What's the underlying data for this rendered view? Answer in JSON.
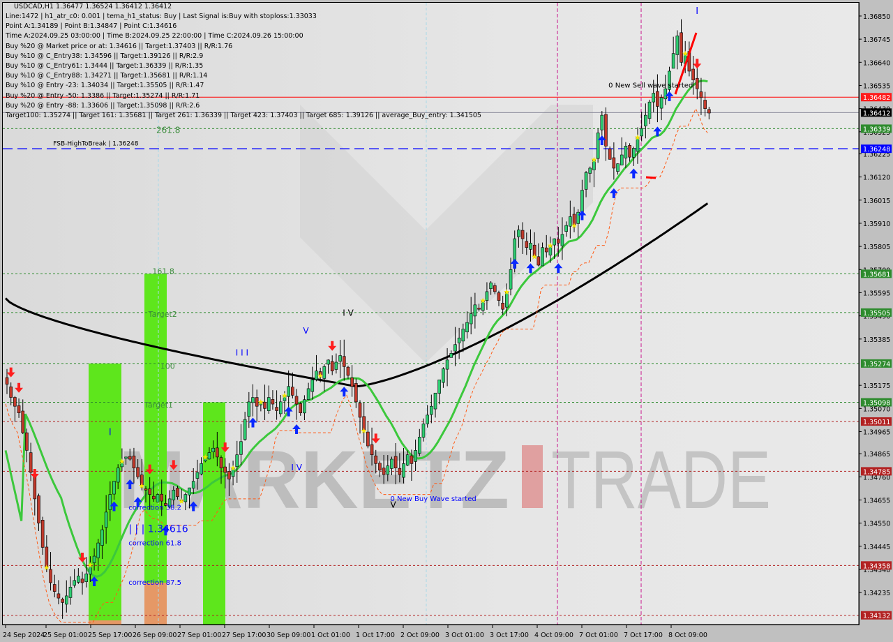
{
  "header": {
    "symbol_line": "USDCAD,H1  1.36477 1.36524 1.36412 1.36412",
    "info_lines": [
      "Line:1472 | h1_atr_c0: 0.001 | tema_h1_status: Buy | Last Signal is:Buy with stoploss:1.33033",
      "Point A:1.34189 | Point B:1.34847 | Point C:1.34616",
      "Time A:2024.09.25 03:00:00 | Time B:2024.09.25 22:00:00 | Time C:2024.09.26 15:00:00",
      "Buy %20 @ Market price or at: 1.34616 || Target:1.37403 || R/R:1.76",
      "Buy %10 @ C_Entry38: 1.34596 || Target:1.39126 || R/R:2.9",
      "Buy %10 @ C_Entry61: 1.3444 || Target:1.36339 || R/R:1.35",
      "Buy %10 @ C_Entry88: 1.34271 || Target:1.35681 || R/R:1.14",
      "Buy %10 @ Entry -23: 1.34034 || Target:1.35505 || R/R:1.47",
      "Buy %20 @ Entry -50: 1.3386 || Target:1.35274 || R/R:1.71",
      "Buy %20 @ Entry -88: 1.33606 || Target:1.35098 || R/R:2.6",
      "Target100: 1.35274 || Target 161: 1.35681 || Target 261: 1.36339 || Target 423: 1.37403 || Target 685: 1.39126 || average_Buy_entry: 1.341505"
    ]
  },
  "watermark": {
    "left": "MARKETZ",
    "right": "TRADE"
  },
  "chart_data": {
    "type": "candlestick",
    "symbol": "USDCAD",
    "timeframe": "H1",
    "ohlc_last": {
      "open": 1.36477,
      "high": 1.36524,
      "low": 1.36412,
      "close": 1.36412
    },
    "ylim": [
      1.3409,
      1.3691
    ],
    "y_ticks": [
      "1.36850",
      "1.36745",
      "1.36640",
      "1.36535",
      "1.36430",
      "1.36325",
      "1.36225",
      "1.36120",
      "1.36015",
      "1.35910",
      "1.35805",
      "1.35700",
      "1.35595",
      "1.35490",
      "1.35385",
      "1.35175",
      "1.35070",
      "1.34965",
      "1.34865",
      "1.34760",
      "1.34655",
      "1.34550",
      "1.34445",
      "1.34340",
      "1.34235"
    ],
    "x_ticks": [
      "24 Sep 2024",
      "25 Sep 01:00",
      "25 Sep 17:00",
      "26 Sep 09:00",
      "27 Sep 01:00",
      "27 Sep 17:00",
      "30 Sep 09:00",
      "1 Oct 01:00",
      "1 Oct 17:00",
      "2 Oct 09:00",
      "3 Oct 01:00",
      "3 Oct 17:00",
      "4 Oct 09:00",
      "7 Oct 01:00",
      "7 Oct 17:00",
      "8 Oct 09:00"
    ],
    "price_path": [
      1.3518,
      1.3512,
      1.3508,
      1.3505,
      1.3496,
      1.3488,
      1.3478,
      1.3466,
      1.3455,
      1.3444,
      1.3435,
      1.3428,
      1.3424,
      1.3421,
      1.3419,
      1.3422,
      1.3426,
      1.3429,
      1.3431,
      1.3428,
      1.3432,
      1.3436,
      1.344,
      1.3446,
      1.3452,
      1.346,
      1.3468,
      1.3474,
      1.348,
      1.3483,
      1.3485,
      1.3484,
      1.348,
      1.3476,
      1.3472,
      1.347,
      1.3468,
      1.3466,
      1.3468,
      1.3465,
      1.3463,
      1.3466,
      1.347,
      1.3467,
      1.3465,
      1.3468,
      1.3471,
      1.3474,
      1.3478,
      1.3482,
      1.3485,
      1.3487,
      1.3489,
      1.3485,
      1.348,
      1.3478,
      1.3475,
      1.348,
      1.3486,
      1.3492,
      1.3502,
      1.351,
      1.3512,
      1.3508,
      1.351,
      1.3507,
      1.3512,
      1.3509,
      1.3506,
      1.351,
      1.3513,
      1.3517,
      1.3513,
      1.3509,
      1.3505,
      1.3511,
      1.3516,
      1.352,
      1.3524,
      1.3522,
      1.3526,
      1.3529,
      1.3524,
      1.3528,
      1.3531,
      1.3526,
      1.3522,
      1.3517,
      1.351,
      1.3503,
      1.3497,
      1.349,
      1.3486,
      1.3482,
      1.3479,
      1.3477,
      1.3481,
      1.3484,
      1.348,
      1.3477,
      1.3482,
      1.3486,
      1.3482,
      1.3488,
      1.3494,
      1.35,
      1.3504,
      1.3508,
      1.3514,
      1.352,
      1.3525,
      1.3529,
      1.3532,
      1.3536,
      1.3539,
      1.3543,
      1.3546,
      1.355,
      1.3554,
      1.3552,
      1.3556,
      1.356,
      1.3564,
      1.356,
      1.3556,
      1.3552,
      1.356,
      1.357,
      1.3584,
      1.3588,
      1.3584,
      1.358,
      1.3582,
      1.3576,
      1.3572,
      1.358,
      1.3578,
      1.3581,
      1.3584,
      1.3582,
      1.3586,
      1.359,
      1.3594,
      1.359,
      1.3596,
      1.3606,
      1.3614,
      1.3616,
      1.362,
      1.3632,
      1.364,
      1.3626,
      1.362,
      1.3616,
      1.3618,
      1.3622,
      1.3626,
      1.3621,
      1.3625,
      1.363,
      1.3634,
      1.364,
      1.3646,
      1.365,
      1.3644,
      1.3648,
      1.3652,
      1.366,
      1.3668,
      1.3676,
      1.3664,
      1.3668,
      1.366,
      1.3656,
      1.3652,
      1.3648,
      1.3643,
      1.3641
    ],
    "horizontal_levels": [
      {
        "label": "1.36482",
        "value": 1.36482,
        "color": "#ff0000",
        "style": "solid"
      },
      {
        "label": "1.36412",
        "value": 1.36412,
        "color": "#000000",
        "style": "solid-grey"
      },
      {
        "label": "1.36339",
        "value": 1.36339,
        "color": "#2e8b2e",
        "style": "dotted"
      },
      {
        "label": "1.36248",
        "value": 1.36248,
        "color": "#0000ff",
        "style": "dashed"
      },
      {
        "label": "1.35681",
        "value": 1.35681,
        "color": "#2e8b2e",
        "style": "dotted"
      },
      {
        "label": "1.35505",
        "value": 1.35505,
        "color": "#2e8b2e",
        "style": "dotted"
      },
      {
        "label": "1.35274",
        "value": 1.35274,
        "color": "#2e8b2e",
        "style": "dotted"
      },
      {
        "label": "1.35098",
        "value": 1.35098,
        "color": "#2e8b2e",
        "style": "dotted"
      },
      {
        "label": "1.35011",
        "value": 1.35011,
        "color": "#b22222",
        "style": "dotted"
      },
      {
        "label": "1.34785",
        "value": 1.34785,
        "color": "#b22222",
        "style": "dotted"
      },
      {
        "label": "1.34358",
        "value": 1.34358,
        "color": "#b22222",
        "style": "dotted"
      },
      {
        "label": "1.34132",
        "value": 1.34132,
        "color": "#b22222",
        "style": "dotted"
      }
    ],
    "annotations": [
      {
        "text": "261.8",
        "price": 1.3632,
        "bar": 38,
        "color": "#3c8c3c",
        "size": 12
      },
      {
        "text": "FSB-HighToBreak | 1.36248",
        "price": 1.36262,
        "bar": 12,
        "color": "#000000",
        "size": 9
      },
      {
        "text": "161.8",
        "price": 1.3568,
        "bar": 37,
        "color": "#3c8c3c",
        "size": 11
      },
      {
        "text": "Target2",
        "price": 1.35485,
        "bar": 36,
        "color": "#3c8c3c",
        "size": 11
      },
      {
        "text": "100",
        "price": 1.3525,
        "bar": 39,
        "color": "#3c8c3c",
        "size": 11
      },
      {
        "text": "Target1",
        "price": 1.35075,
        "bar": 35,
        "color": "#3c8c3c",
        "size": 11
      },
      {
        "text": "correction 38.2",
        "price": 1.3461,
        "bar": 31,
        "color": "#0000ff",
        "size": 10
      },
      {
        "text": "| | | 1.34616",
        "price": 1.3451,
        "bar": 31,
        "color": "#0000ff",
        "size": 14
      },
      {
        "text": "correction 61.8",
        "price": 1.3445,
        "bar": 31,
        "color": "#0000ff",
        "size": 10
      },
      {
        "text": "correction 87.5",
        "price": 1.3427,
        "bar": 31,
        "color": "#0000ff",
        "size": 10
      },
      {
        "text": "0 New Buy Wave started",
        "price": 1.3465,
        "bar": 97,
        "color": "#0000ff",
        "size": 10
      },
      {
        "text": "0 New Sell wave started",
        "price": 1.36525,
        "bar": 152,
        "color": "#000000",
        "size": 10
      },
      {
        "text": "I",
        "price": 1.3495,
        "bar": 26,
        "color": "#0000ff",
        "size": 13
      },
      {
        "text": "I I I",
        "price": 1.3531,
        "bar": 58,
        "color": "#0000ff",
        "size": 12
      },
      {
        "text": "V",
        "price": 1.3541,
        "bar": 75,
        "color": "#0000ff",
        "size": 12
      },
      {
        "text": "I V",
        "price": 1.3549,
        "bar": 85,
        "color": "#000000",
        "size": 12
      },
      {
        "text": "I V",
        "price": 1.3479,
        "bar": 72,
        "color": "#0000ff",
        "size": 12
      },
      {
        "text": "V",
        "price": 1.3462,
        "bar": 97,
        "color": "#000000",
        "size": 12
      },
      {
        "text": "I",
        "price": 1.3686,
        "bar": 174,
        "color": "#0000ff",
        "size": 13
      }
    ],
    "vertical_markers": [
      {
        "time": "4 Oct 09:00 (approx)",
        "color": "#c8148c"
      },
      {
        "time": "7 Oct 17:00 (approx)",
        "color": "#c8148c"
      }
    ],
    "moving_averages": [
      {
        "name": "slow MA",
        "color": "#000000"
      },
      {
        "name": "fast MA",
        "color": "#3cc83c"
      }
    ],
    "zones": [
      {
        "name": "green zone 1",
        "color": "#5ee61c"
      },
      {
        "name": "green zone 2",
        "color": "#5ee61c"
      },
      {
        "name": "green zone 3",
        "color": "#5ee61c"
      },
      {
        "name": "correction 87.5 zone",
        "color": "#e59866"
      }
    ]
  }
}
